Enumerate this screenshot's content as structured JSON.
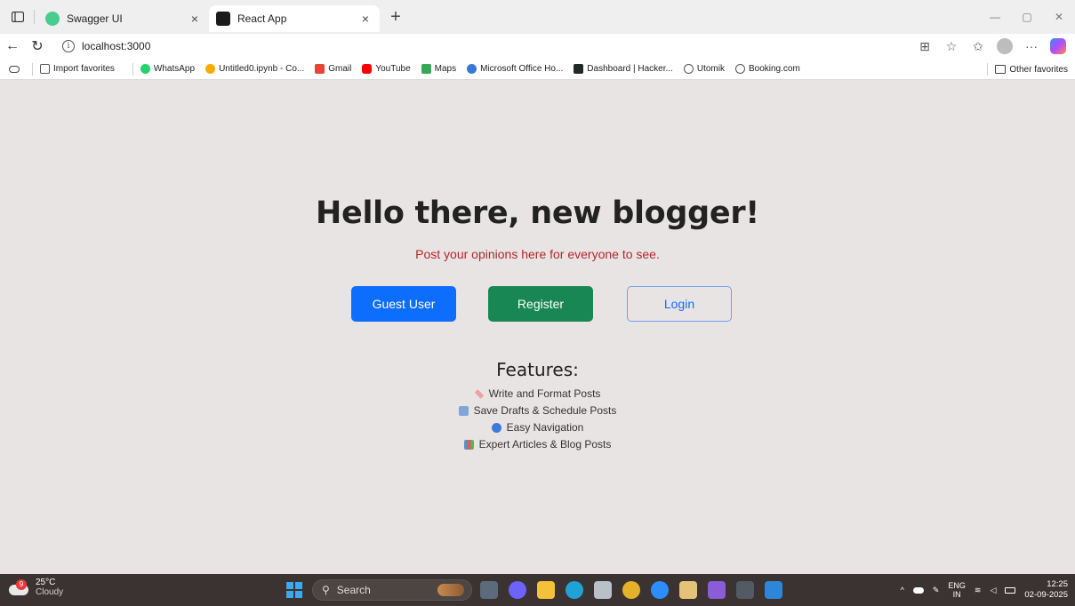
{
  "browser": {
    "tabs": [
      {
        "title": "Swagger UI",
        "active": false,
        "favicon_color": "#49cc90"
      },
      {
        "title": "React App",
        "active": true,
        "favicon_color": "#1b1b1b"
      }
    ],
    "address": "localhost:3000",
    "favorites": [
      {
        "label": "Import favorites",
        "icon": "import-icon",
        "color": "#555555"
      },
      {
        "label": "WhatsApp",
        "icon": "whatsapp-icon",
        "color": "#25d366"
      },
      {
        "label": "Untitled0.ipynb - Co...",
        "icon": "colab-icon",
        "color": "#f9ab00"
      },
      {
        "label": "Gmail",
        "icon": "gmail-icon",
        "color": "#ea4335"
      },
      {
        "label": "YouTube",
        "icon": "youtube-icon",
        "color": "#ff0000"
      },
      {
        "label": "Maps",
        "icon": "maps-icon",
        "color": "#34a853"
      },
      {
        "label": "Microsoft Office Ho...",
        "icon": "office-icon",
        "color": "#3a78d8"
      },
      {
        "label": "Dashboard | Hacker...",
        "icon": "hackerrank-icon",
        "color": "#1e2a24"
      },
      {
        "label": "Utomik",
        "icon": "globe-icon",
        "color": "#555555"
      },
      {
        "label": "Booking.com",
        "icon": "globe-icon",
        "color": "#555555"
      }
    ],
    "other_favorites": "Other favorites"
  },
  "page": {
    "title": "Hello there, new blogger!",
    "subtitle": "Post your opinions here for everyone to see.",
    "buttons": {
      "guest": "Guest User",
      "register": "Register",
      "login": "Login"
    },
    "features_title": "Features:",
    "features": [
      {
        "label": "Write and Format Posts",
        "icon": "pencil-emoji-icon",
        "color": "#f0a0a0"
      },
      {
        "label": "Save Drafts & Schedule Posts",
        "icon": "calendar-emoji-icon",
        "color": "#7fa6d9"
      },
      {
        "label": "Easy Navigation",
        "icon": "magnifier-emoji-icon",
        "color": "#3b7ad9"
      },
      {
        "label": "Expert Articles & Blog Posts",
        "icon": "books-emoji-icon",
        "color": "#5a8fd0"
      }
    ],
    "colors": {
      "background": "#e9e4e4",
      "subtitle": "#b1272a",
      "guest": "#0d6efd",
      "register": "#198754"
    }
  },
  "taskbar": {
    "weather": {
      "temp": "25°C",
      "condition": "Cloudy",
      "badge": "9"
    },
    "search_placeholder": "Search",
    "apps": [
      {
        "icon": "files-icon",
        "color": "#5b6b7b"
      },
      {
        "icon": "copilot-icon",
        "color": "#6c63ff"
      },
      {
        "icon": "file-explorer-icon",
        "color": "#f3c13a"
      },
      {
        "icon": "edge-icon",
        "color": "#1fa3d6"
      },
      {
        "icon": "calculator-icon",
        "color": "#b9c0c8"
      },
      {
        "icon": "chrome-icon",
        "color": "#e3b22b"
      },
      {
        "icon": "zoom-icon",
        "color": "#2d8cff"
      },
      {
        "icon": "paint-icon",
        "color": "#e4c27a"
      },
      {
        "icon": "visual-studio-icon",
        "color": "#8a5cd6"
      },
      {
        "icon": "terminal-icon",
        "color": "#525a63"
      },
      {
        "icon": "vscode-icon",
        "color": "#2f86d6"
      }
    ],
    "language": {
      "line1": "ENG",
      "line2": "IN"
    },
    "time": "12:25",
    "date": "02-09-2025"
  }
}
